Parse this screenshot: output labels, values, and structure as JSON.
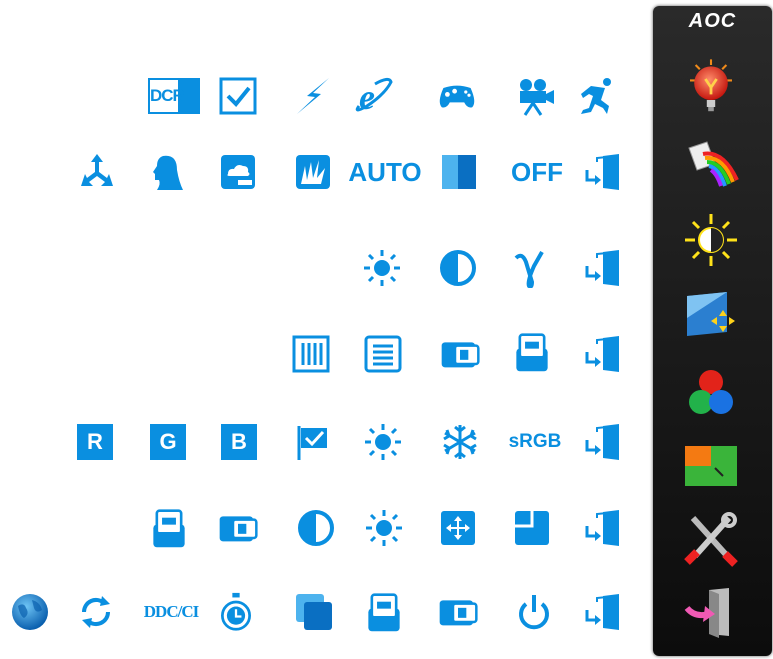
{
  "brand": "AOC",
  "labels": {
    "dcr": "DCR",
    "auto": "AUTO",
    "off": "OFF",
    "r": "R",
    "g": "G",
    "b": "B",
    "srgb": "sRGB",
    "ddcci": "DDC/CI"
  },
  "colors": {
    "accent": "#0a8fe0",
    "panel": "#1a1a1a",
    "highlight": "#e23b2a"
  },
  "menu_items": [
    "luminance-icon",
    "image-setup-icon",
    "color-setup-icon",
    "picture-boost-icon",
    "rgb-color-icon",
    "osd-setup-icon",
    "extra-tools-icon",
    "exit-icon"
  ]
}
